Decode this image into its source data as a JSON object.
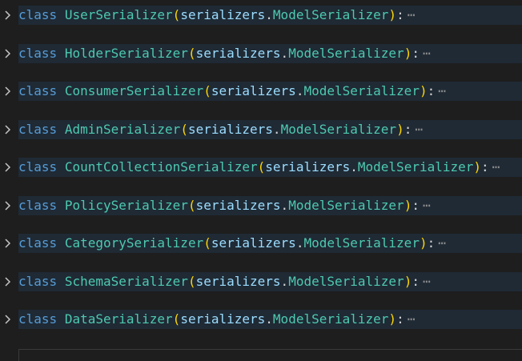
{
  "editor": {
    "keyword": "class",
    "base_module": "serializers",
    "base_class": "ModelSerializer",
    "fold_marker": "⋯",
    "lines": [
      {
        "class_name": "UserSerializer"
      },
      {
        "class_name": "HolderSerializer"
      },
      {
        "class_name": "ConsumerSerializer"
      },
      {
        "class_name": "AdminSerializer"
      },
      {
        "class_name": "CountCollectionSerializer"
      },
      {
        "class_name": "PolicySerializer"
      },
      {
        "class_name": "CategorySerializer"
      },
      {
        "class_name": "SchemaSerializer"
      },
      {
        "class_name": "DataSerializer"
      }
    ]
  },
  "icons": {
    "fold_toggle": "chevron-right-icon",
    "fold_marker": "ellipsis-icon"
  },
  "colors": {
    "background": "#1e1e1e",
    "keyword": "#569cd6",
    "class_name": "#4ec9b0",
    "bracket": "#ffd700",
    "identifier": "#9cdcfe",
    "folded_line_highlight": "#1f2a35"
  }
}
